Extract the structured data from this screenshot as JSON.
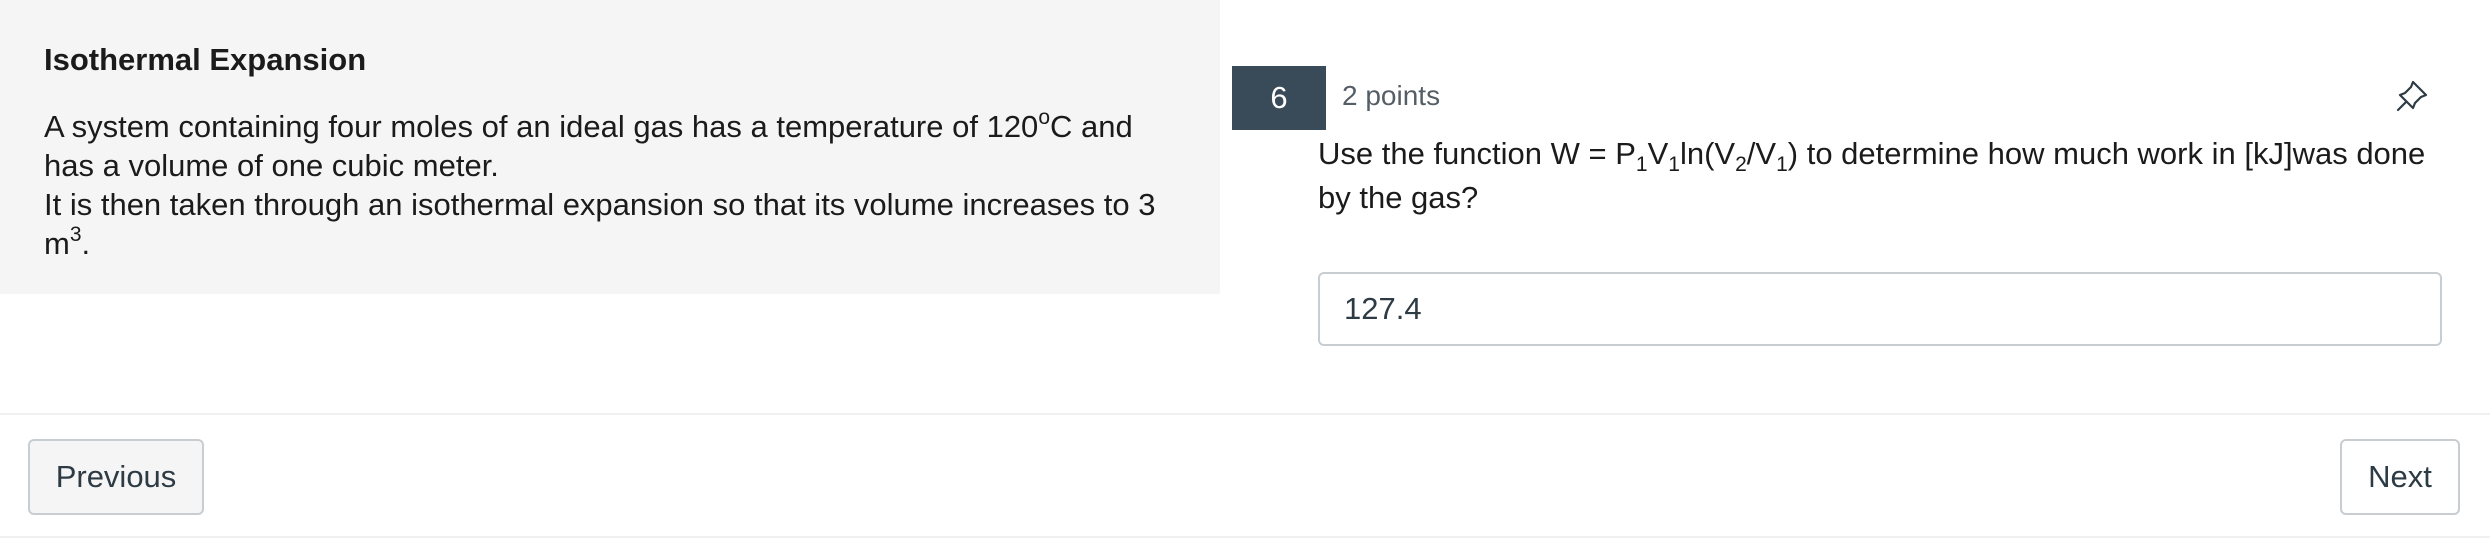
{
  "stimulus": {
    "title": "Isothermal Expansion",
    "line1_a": "A system containing four moles of an ideal gas has a temperature of 120",
    "line1_sup": "o",
    "line1_b": "C and",
    "line2": "has a volume of one cubic meter.",
    "line3": "It is then taken through an isothermal expansion so that its volume increases to 3",
    "line4_a": "m",
    "line4_sup": "3",
    "line4_b": "."
  },
  "question": {
    "number": "6",
    "points": "2 points",
    "pin_icon": "pin-icon",
    "prompt_parts": [
      "Use the function W = P",
      "1",
      "V",
      "1",
      "ln(V",
      "2",
      "/V",
      "1",
      ") to determine how much work in [kJ]was done by the gas?"
    ],
    "answer_value": "127.4"
  },
  "navigation": {
    "previous_label": "Previous",
    "next_label": "Next"
  }
}
